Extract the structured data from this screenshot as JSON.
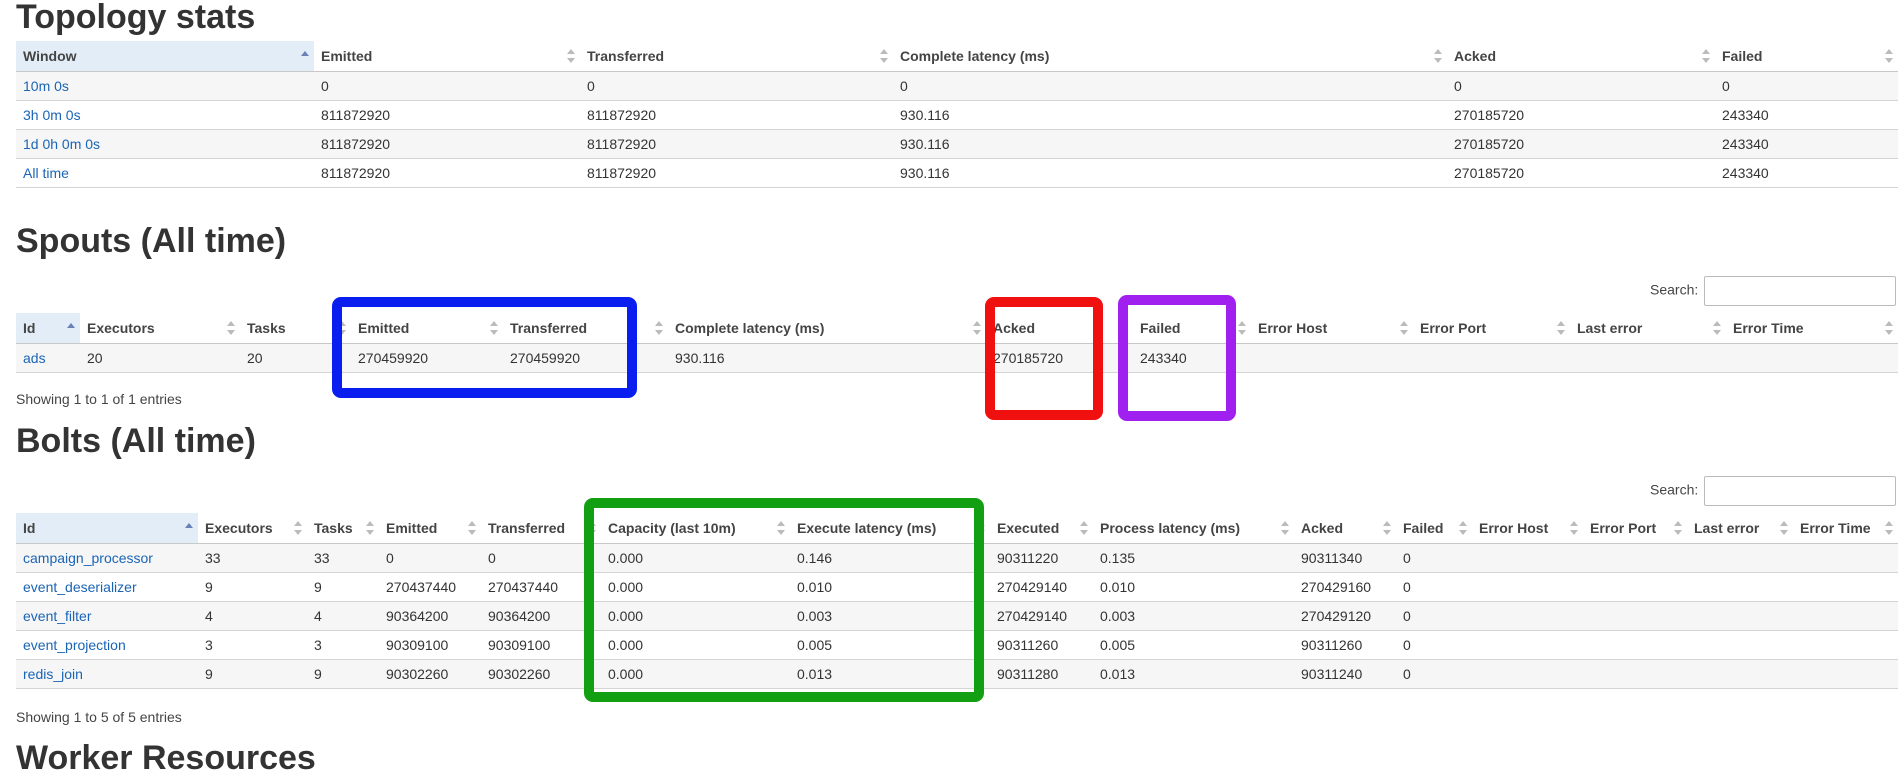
{
  "topology": {
    "title": "Topology stats",
    "headers": [
      "Window",
      "Emitted",
      "Transferred",
      "Complete latency (ms)",
      "Acked",
      "Failed"
    ],
    "rows": [
      [
        "10m 0s",
        "0",
        "0",
        "0",
        "0",
        "0"
      ],
      [
        "3h 0m 0s",
        "811872920",
        "811872920",
        "930.116",
        "270185720",
        "243340"
      ],
      [
        "1d 0h 0m 0s",
        "811872920",
        "811872920",
        "930.116",
        "270185720",
        "243340"
      ],
      [
        "All time",
        "811872920",
        "811872920",
        "930.116",
        "270185720",
        "243340"
      ]
    ]
  },
  "spouts": {
    "title": "Spouts (All time)",
    "search_label": "Search:",
    "headers": [
      "Id",
      "Executors",
      "Tasks",
      "Emitted",
      "Transferred",
      "Complete latency (ms)",
      "Acked",
      "Failed",
      "Error Host",
      "Error Port",
      "Last error",
      "Error Time"
    ],
    "rows": [
      [
        "ads",
        "20",
        "20",
        "270459920",
        "270459920",
        "930.116",
        "270185720",
        "243340",
        "",
        "",
        "",
        ""
      ]
    ],
    "showing": "Showing 1 to 1 of 1 entries"
  },
  "bolts": {
    "title": "Bolts (All time)",
    "search_label": "Search:",
    "headers": [
      "Id",
      "Executors",
      "Tasks",
      "Emitted",
      "Transferred",
      "Capacity (last 10m)",
      "Execute latency (ms)",
      "Executed",
      "Process latency (ms)",
      "Acked",
      "Failed",
      "Error Host",
      "Error Port",
      "Last error",
      "Error Time"
    ],
    "rows": [
      [
        "campaign_processor",
        "33",
        "33",
        "0",
        "0",
        "0.000",
        "0.146",
        "90311220",
        "0.135",
        "90311340",
        "0",
        "",
        "",
        "",
        ""
      ],
      [
        "event_deserializer",
        "9",
        "9",
        "270437440",
        "270437440",
        "0.000",
        "0.010",
        "270429140",
        "0.010",
        "270429160",
        "0",
        "",
        "",
        "",
        ""
      ],
      [
        "event_filter",
        "4",
        "4",
        "90364200",
        "90364200",
        "0.000",
        "0.003",
        "270429140",
        "0.003",
        "270429120",
        "0",
        "",
        "",
        "",
        ""
      ],
      [
        "event_projection",
        "3",
        "3",
        "90309100",
        "90309100",
        "0.000",
        "0.005",
        "90311260",
        "0.005",
        "90311260",
        "0",
        "",
        "",
        "",
        ""
      ],
      [
        "redis_join",
        "9",
        "9",
        "90302260",
        "90302260",
        "0.000",
        "0.013",
        "90311280",
        "0.013",
        "90311240",
        "0",
        "",
        "",
        "",
        ""
      ]
    ],
    "showing": "Showing 1 to 5 of 5 entries"
  },
  "worker": {
    "title": "Worker Resources"
  },
  "highlights": [
    {
      "name": "blue-highlight-box",
      "color": "#0a1ef0"
    },
    {
      "name": "red-highlight-box",
      "color": "#f01010"
    },
    {
      "name": "purple-highlight-box",
      "color": "#a020f0"
    },
    {
      "name": "green-highlight-box",
      "color": "#12a012"
    }
  ]
}
